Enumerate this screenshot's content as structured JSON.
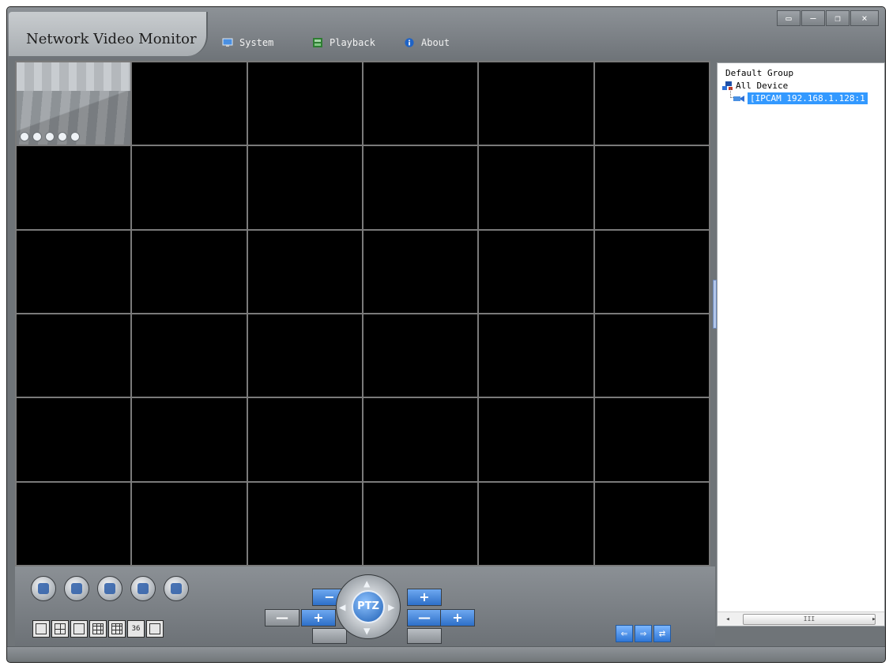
{
  "app": {
    "title": "Network Video Monitor"
  },
  "menu": {
    "system": "System",
    "playback": "Playback",
    "about": "About"
  },
  "window_controls": {
    "restore_small": "▭",
    "minimize": "—",
    "maximize": "❐",
    "close": "×"
  },
  "device_tree": {
    "root": "Default Group",
    "group": "All Device",
    "selected_device": "[IPCAM 192.168.1.128:1"
  },
  "scrollbar": {
    "left_arrow": "◂",
    "right_arrow": "▸",
    "thumb_grip": "III"
  },
  "layout_buttons": {
    "l36": "36"
  },
  "ptz": {
    "center_label": "PTZ",
    "up": "▲",
    "down": "▼",
    "left": "◀",
    "right": "▶",
    "minus_label": "—",
    "plus_label": "+"
  },
  "nav": {
    "prev": "⇐",
    "next": "⇒",
    "swap": "⇄"
  },
  "colors": {
    "selection": "#3399ff",
    "window": "#6f7478",
    "video_bg": "#000000"
  },
  "icons": {
    "system": "monitor-icon",
    "playback": "film-icon",
    "about": "info-icon",
    "group": "network-icon",
    "device": "camera-icon"
  }
}
